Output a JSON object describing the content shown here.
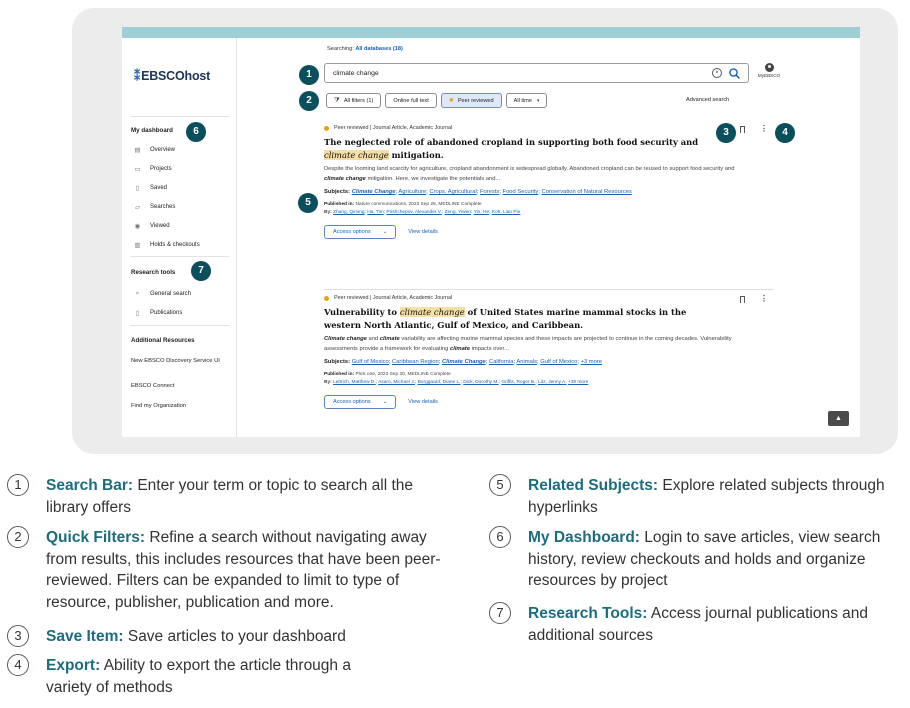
{
  "sidebar": {
    "logo": "EBSCOhost",
    "logo_mark": "⁑",
    "dashboard_heading": "My dashboard",
    "dashboard_items": [
      {
        "label": "Overview"
      },
      {
        "label": "Projects"
      },
      {
        "label": "Saved"
      },
      {
        "label": "Searches"
      },
      {
        "label": "Viewed"
      },
      {
        "label": "Holds & checkouts"
      }
    ],
    "research_heading": "Research tools",
    "research_items": [
      {
        "label": "General search"
      },
      {
        "label": "Publications"
      }
    ],
    "additional_heading": "Additional Resources",
    "additional_items": [
      {
        "label": "New EBSCO Discovery Service UI"
      },
      {
        "label": "EBSCO Connect"
      },
      {
        "label": "Find my Organization"
      }
    ]
  },
  "search": {
    "searching_prefix": "Searching:",
    "searching_link": "All databases (18)",
    "value": "climate change",
    "myebsco": "MyEBSCO"
  },
  "filters": {
    "all_filters": "All filters (1)",
    "online_full_text": "Online full text",
    "peer_reviewed": "Peer reviewed",
    "all_time": "All time",
    "advanced": "Advanced search"
  },
  "results": [
    {
      "meta": "Peer reviewed | Journal Article, Academic Journal",
      "title_a": "The neglected role of abandoned cropland in supporting both food security and ",
      "title_hl": "climate change",
      "title_b": " mitigation.",
      "abstract_a": "Despite the looming land scarcity for agriculture, cropland abandonment is widespread globally. Abandoned cropland can be reused to support food security and ",
      "abstract_b": "climate change",
      "abstract_c": " mitigation. Here, we investigate the potentials and...",
      "subjects_label": "Subjects: ",
      "subjects": [
        "Climate Change",
        "Agriculture",
        "Crops, Agricultural",
        "Forests",
        "Food Security",
        "Conservation of Natural Resources"
      ],
      "published_label": "Published in:",
      "published": " Nature communications, 2023 Sep 28, MEDLINE Complete",
      "by_label": "By:",
      "authors": [
        "Zhang, Qiming",
        "Ha, Tim",
        "Prishchepov, Alexander V.",
        "Zeng, Yiwen",
        "Yin, He",
        "Koh, Lian Pin"
      ],
      "access": "Access options",
      "details": "View details"
    },
    {
      "meta": "Peer reviewed | Journal Article, Academic Journal",
      "title_a": "Vulnerability to ",
      "title_hl": "climate change",
      "title_b": " of United States marine mammal stocks in the western North Atlantic, Gulf of Mexico, and Caribbean.",
      "abstract_a": "Climate change",
      "abstract_b": " and ",
      "abstract_c": "climate",
      "abstract_d": " variability are affecting marine mammal species and these impacts are projected to continue in the coming decades. Vulnerability assessments provide a framework for evaluating ",
      "abstract_e": "climate",
      "abstract_f": " impacts over...",
      "subjects_label": "Subjects: ",
      "subjects": [
        "Gulf of Mexico",
        "Caribbean Region",
        "Climate Change",
        "California",
        "Animals",
        "Gulf of Mexico"
      ],
      "subjects_more": "+3 more",
      "published_label": "Published in:",
      "published": " PloS one, 2023 Sep 20, MEDLINE Complete",
      "by_label": "By:",
      "authors": [
        "Lettrich, Matthew D.",
        "Asaro, Michael J.",
        "Borggaard, Diane L.",
        "Dick, Dorothy M.",
        "Griffis, Roger B.",
        "Litz, Jenny A."
      ],
      "authors_more": "+39 more",
      "access": "Access options",
      "details": "View details"
    }
  ],
  "markers": [
    "1",
    "2",
    "3",
    "4",
    "5",
    "6",
    "7"
  ],
  "legend": [
    {
      "num": "1",
      "title": "Search Bar:",
      "text": " Enter your term or topic to search all the library offers"
    },
    {
      "num": "2",
      "title": "Quick Filters:",
      "text": " Refine a search without navigating away from results, this includes resources that have been peer-reviewed. Filters can be expanded to limit to type of resource, publisher, publication and more."
    },
    {
      "num": "3",
      "title": "Save Item:",
      "text": " Save articles to your dashboard"
    },
    {
      "num": "4",
      "title": "Export:",
      "text": " Ability to export the article through a variety of methods"
    },
    {
      "num": "5",
      "title": "Related Subjects:",
      "text": " Explore related subjects through hyperlinks"
    },
    {
      "num": "6",
      "title": "My Dashboard:",
      "text": " Login to save articles, view search history, review checkouts and holds and organize resources by project"
    },
    {
      "num": "7",
      "title": "Research Tools:",
      "text": " Access journal publications and additional sources"
    }
  ],
  "colors": {
    "marker": "#0b4f5c",
    "legend_title": "#1b6d7e",
    "link": "#1a5fb4",
    "highlight": "#f6dfa4",
    "peer_dot": "#e6a21b"
  }
}
